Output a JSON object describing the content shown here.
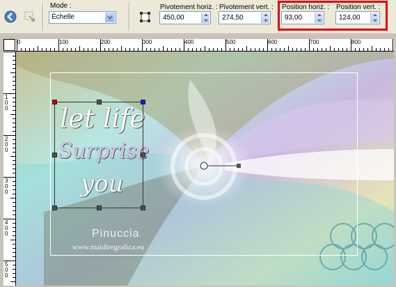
{
  "toolbar": {
    "mode_label": "Mode :",
    "mode_value": "Échelle",
    "pivot_h_label": "Pivotement horiz. :",
    "pivot_h_value": "450,00",
    "pivot_v_label": "Pivotement vert. :",
    "pivot_v_value": "274,50",
    "pos_h_label": "Position horiz. :",
    "pos_h_value": "93,00",
    "pos_v_label": "Position vert. :",
    "pos_v_value": "124,00"
  },
  "ruler": {
    "h_ticks": [
      "0",
      "100",
      "200",
      "300",
      "400",
      "500",
      "600",
      "700",
      "800"
    ],
    "v_ticks": [
      "1\n0\n0",
      "2\n0\n0",
      "3\n0\n0",
      "4\n0\n0",
      "5\n0\n0"
    ]
  },
  "artwork": {
    "text_line1": "let life",
    "text_line2": "Surprise",
    "text_line3": "you",
    "watermark_title": "Pinuccia",
    "watermark_sub": "www.maidiregrafica.eu"
  },
  "colors": {
    "highlight": "#e0000d",
    "bg_teal": "#7fd9d4",
    "bg_lavender": "#c7b4e0",
    "bg_olive": "#bfb88a"
  }
}
